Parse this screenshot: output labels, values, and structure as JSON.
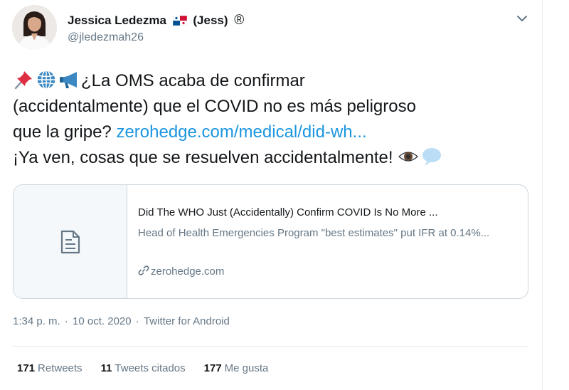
{
  "author": {
    "name": "Jessica Ledezma",
    "nickname": "(Jess)",
    "registered_mark": "®",
    "handle": "@jledezmah26"
  },
  "icons": {
    "flag": "panama-flag-icon",
    "caret": "chevron-down-icon",
    "pin": "pushpin-emoji",
    "globe": "globe-emoji",
    "megaphone": "megaphone-emoji",
    "eye": "eye-emoji",
    "speech": "speech-bubble-emoji",
    "document": "document-icon",
    "link": "link-icon"
  },
  "tweet": {
    "line1": "¿La OMS acaba de confirmar",
    "line2": "(accidentalmente) que el COVID no es más peligroso",
    "line3_text": "que la gripe? ",
    "line3_link": "zerohedge.com/medical/did-wh...",
    "line4": "¡Ya ven, cosas que se resuelven accidentalmente! "
  },
  "card": {
    "title": "Did The WHO Just (Accidentally) Confirm COVID Is No More ...",
    "description": "Head of Health Emergencies Program \"best estimates\" put IFR at 0.14%...",
    "domain": "zerohedge.com"
  },
  "meta": {
    "time": "1:34 p. m.",
    "separator": " · ",
    "date": "10 oct. 2020",
    "source": "Twitter for Android"
  },
  "stats": {
    "retweets_count": "171",
    "retweets_label": "Retweets",
    "quotes_count": "11",
    "quotes_label": "Tweets citados",
    "likes_count": "177",
    "likes_label": "Me gusta"
  },
  "colors": {
    "link": "#1b95e0",
    "secondary_text": "#657786",
    "border": "#ccd6dd"
  }
}
